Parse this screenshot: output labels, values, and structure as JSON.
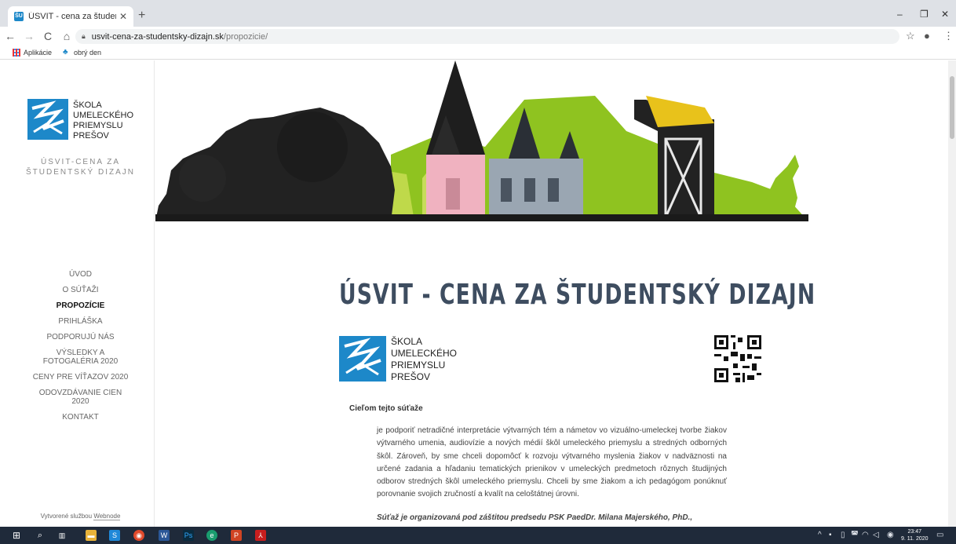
{
  "browser": {
    "tab_title": "ÚSVIT - cena za študentský dizaj",
    "url_host": "usvit-cena-za-studentsky-dizajn.sk",
    "url_path": "/propozicie/",
    "bookmarks": [
      "Aplikácie",
      "obrý den"
    ]
  },
  "sidebar": {
    "logo_lines": [
      "ŠKOLA",
      "UMELECKÉHO",
      "PRIEMYSLU",
      "PREŠOV"
    ],
    "site_name": "ÚSVIT-CENA ZA ŠTUDENTSKÝ DIZAJN",
    "nav": [
      {
        "label": "ÚVOD",
        "active": false
      },
      {
        "label": "O SÚŤAŽI",
        "active": false
      },
      {
        "label": "PROPOZÍCIE",
        "active": true
      },
      {
        "label": "PRIHLÁŠKA",
        "active": false
      },
      {
        "label": "PODPORUJÚ NÁS",
        "active": false
      },
      {
        "label": "VÝSLEDKY A FOTOGALÉRIA 2020",
        "active": false
      },
      {
        "label": "CENY PRE VÍŤAZOV 2020",
        "active": false
      },
      {
        "label": "ODOVZDÁVANIE CIEN 2020",
        "active": false
      },
      {
        "label": "KONTAKT",
        "active": false
      }
    ],
    "credit_prefix": "Vytvorené službou",
    "credit_link": "Webnode"
  },
  "main": {
    "title": "ÚSVIT - CENA ZA ŠTUDENTSKÝ DIZAJN",
    "logo_lines": [
      "ŠKOLA",
      "UMELECKÉHO",
      "PRIEMYSLU",
      "PREŠOV"
    ],
    "intro_heading": "Cieľom tejto súťaže",
    "paragraph": "je podporiť netradičné interpretácie výtvarných tém a námetov vo vizuálno-umeleckej tvorbe žiakov výtvarného umenia, audiovízie a nových médií škôl umeleckého priemyslu a stredných odborných škôl. Zároveň, by sme chceli dopomôcť k rozvoju výtvarného myslenia žiakov v nadväznosti na určené zadania a hľadaniu tematických prienikov v umeleckých predmetoch rôznych študijných odborov stredných škôl umeleckého priemyslu. Chceli by sme žiakom a ich pedagógom ponúknuť porovnanie svojich zručností a kvalít na celoštátnej úrovni.",
    "paragraph2": "Súťaž je organizovaná pod záštitou predsedu PSK PaedDr. Milana Majerského, PhD.,"
  },
  "taskbar": {
    "time": "23:47",
    "date": "9. 11. 2020"
  },
  "colors": {
    "logo_blue": "#1d88c9",
    "title": "#3e4d60",
    "banner_green": "#8fc320",
    "banner_pink": "#f0b2c0",
    "taskbar": "#1f2a3a"
  }
}
